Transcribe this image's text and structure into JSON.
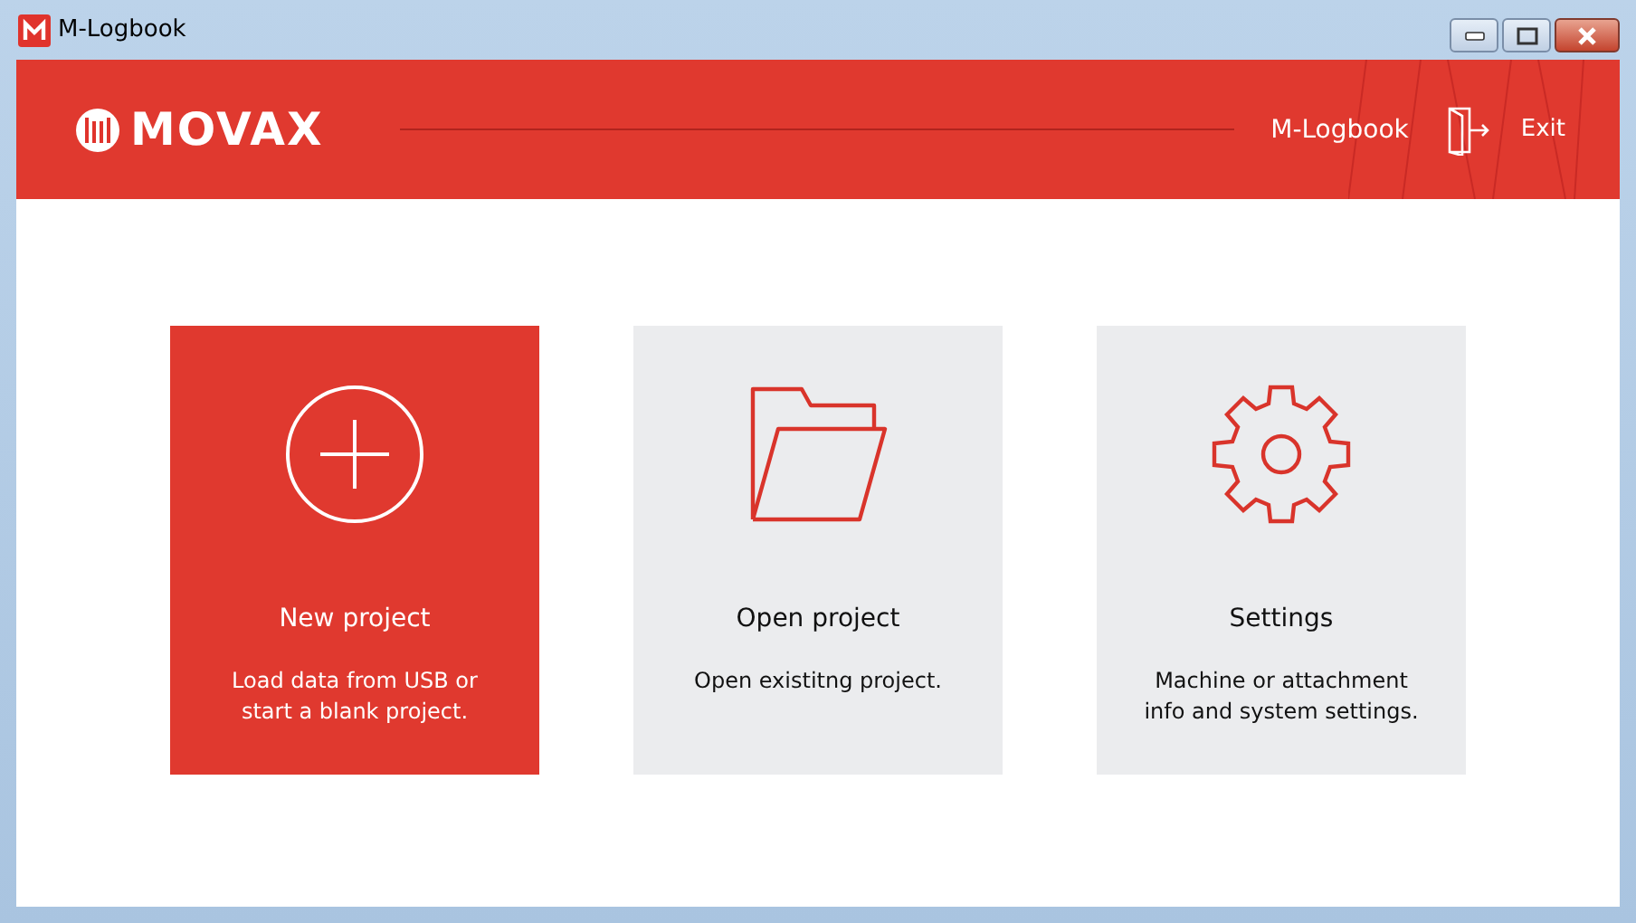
{
  "window": {
    "title": "M-Logbook"
  },
  "header": {
    "logo": "MOVAX",
    "app_name": "M-Logbook",
    "exit_label": "Exit"
  },
  "cards": [
    {
      "kind": "new",
      "title": "New project",
      "description": "Load data from USB or start a blank project.",
      "selected": true
    },
    {
      "kind": "open",
      "title": "Open project",
      "description": "Open existitng project.",
      "selected": false
    },
    {
      "kind": "settings",
      "title": "Settings",
      "description": "Machine or attachment info and system settings.",
      "selected": false
    }
  ]
}
